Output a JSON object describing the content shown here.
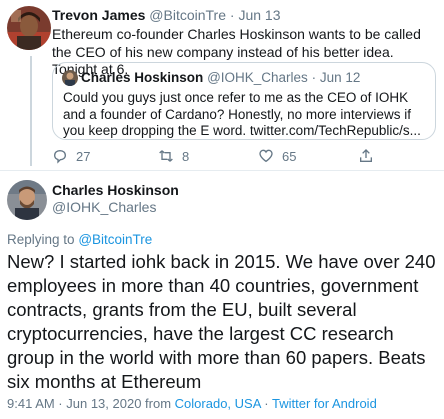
{
  "parent": {
    "author_name": "Trevon James",
    "author_handle": "@BitcoinTre",
    "separator": "·",
    "date": "Jun 13",
    "text": "Ethereum co-founder Charles Hoskinson wants to be called the CEO of his new company instead of his better idea. Tonight at 6.",
    "quote": {
      "author_name": "Charles Hoskinson",
      "author_handle": "@IOHK_Charles",
      "separator": "·",
      "date": "Jun 12",
      "text": "Could you guys just once refer to me as the CEO of IOHK and a founder of Cardano? Honestly, no more interviews if you keep dropping the E word. twitter.com/TechRepublic/s..."
    },
    "actions": {
      "reply_count": "27",
      "retweet_count": "8",
      "like_count": "65"
    }
  },
  "main": {
    "author_name": "Charles Hoskinson",
    "author_handle": "@IOHK_Charles",
    "replying_prefix": "Replying to",
    "replying_handle": "@BitcoinTre",
    "text": "New? I started iohk back in 2015. We have over 240 employees in more than 40 countries, government contracts, grants from the EU, built several cryptocurrencies, have the largest CC research group in the world with more than 60 papers. Beats six months at Ethereum",
    "timestamp": "9:41 AM · Jun 13, 2020 from",
    "location": "Colorado, USA",
    "meta_separator": "·",
    "source": "Twitter for Android"
  },
  "colors": {
    "link": "#1b95e0",
    "secondary": "#657786",
    "text": "#14171a",
    "border": "#ccd6dd"
  },
  "icons": {
    "reply": "reply-icon",
    "retweet": "retweet-icon",
    "like": "heart-icon",
    "share": "share-icon"
  }
}
